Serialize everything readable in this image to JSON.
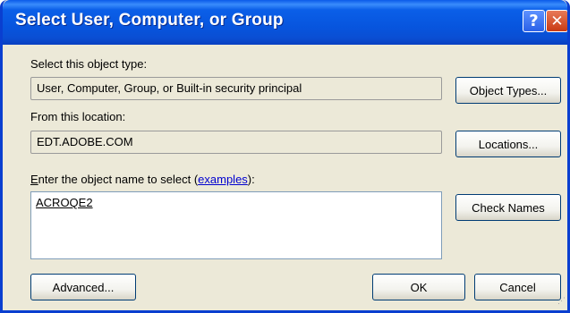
{
  "window": {
    "title": "Select User, Computer, or Group",
    "help_glyph": "?",
    "close_glyph": "✕"
  },
  "object_type": {
    "label": "Select this object type:",
    "value": "User, Computer, Group, or Built-in security principal",
    "button": "Object Types..."
  },
  "location": {
    "label": "From this location:",
    "value": "EDT.ADOBE.COM",
    "button": "Locations..."
  },
  "object_name": {
    "label_prefix": "E",
    "label_rest": "nter the object name to select (",
    "link": "examples",
    "label_suffix": "):",
    "value": "ACROQE2",
    "button": "Check Names"
  },
  "footer": {
    "advanced": "Advanced...",
    "ok": "OK",
    "cancel": "Cancel"
  },
  "colors": {
    "title_bar": "#0755de",
    "window_bg": "#ece9d8",
    "close_button": "#c93a12",
    "link": "#0000d0"
  }
}
